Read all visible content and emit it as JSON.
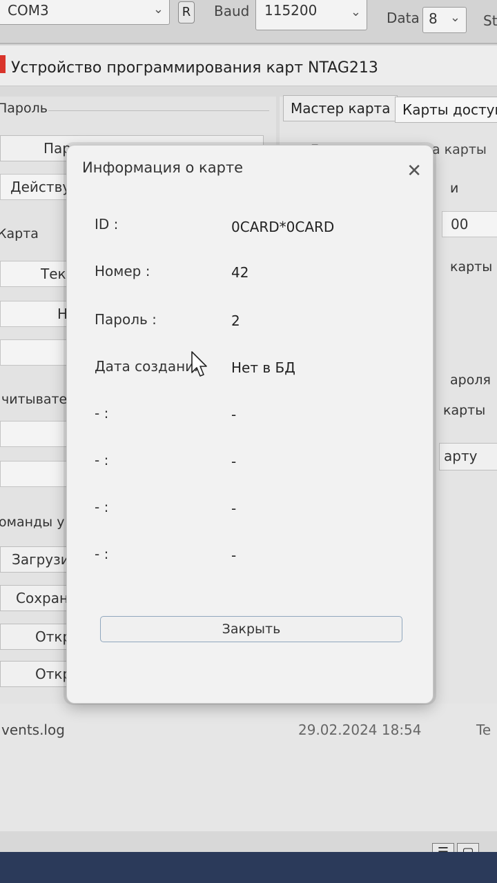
{
  "toolbar": {
    "port_value": "COM3",
    "refresh_label": "R",
    "baud_label": "Baud",
    "baud_value": "115200",
    "data_label": "Data",
    "data_value": "8",
    "stop_label": "St"
  },
  "window": {
    "title": "Устройство программирования карт NTAG213"
  },
  "left_panel": {
    "password_group": "Пароль",
    "password_button": "Пар",
    "action_field": "Действу",
    "card_group": "Карта",
    "current_label": "Теку",
    "new_label": "Н",
    "reader_group": "читывате",
    "commands_group": "оманды у",
    "load_button": "Загрузи",
    "save_button": "Сохран",
    "open_button_1": "Откр",
    "open_button_2": "Откр"
  },
  "right_panel": {
    "tab_master": "Мастер карта",
    "tab_access": "Карты доступ",
    "gen_group": "Генерация номера карты",
    "gen_suffix": "и",
    "number_value": "00",
    "card_label": "карты",
    "password_label": "ароля",
    "cards_label": "карты",
    "card_button": "арту"
  },
  "file_list": [
    {
      "name": "vents.log",
      "date": "29.02.2024 18:54",
      "type": "Te"
    }
  ],
  "dialog": {
    "title": "Информация о карте",
    "close_icon": "close-icon",
    "rows": [
      {
        "label": "ID :",
        "value": "0CARD*0CARD"
      },
      {
        "label": "Номер :",
        "value": "42"
      },
      {
        "label": "Пароль :",
        "value": "2"
      },
      {
        "label": "Дата создания",
        "value": "Нет в БД"
      },
      {
        "label": "- :",
        "value": "-"
      },
      {
        "label": "- :",
        "value": "-"
      },
      {
        "label": "- :",
        "value": "-"
      },
      {
        "label": "- :",
        "value": "-"
      }
    ],
    "close_button": "Закрыть"
  }
}
